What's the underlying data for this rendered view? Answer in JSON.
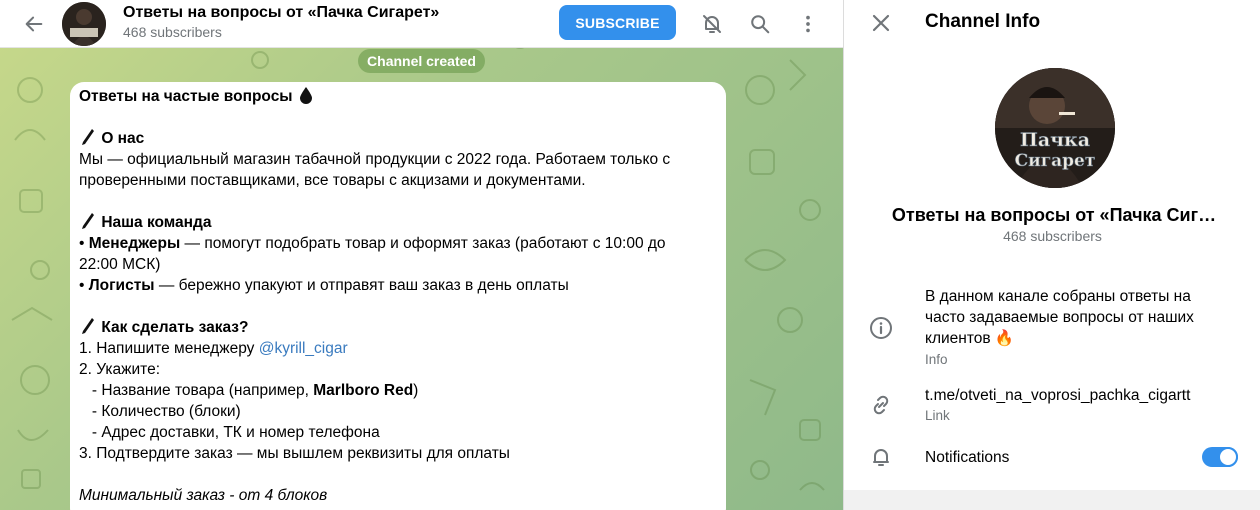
{
  "header": {
    "channel_title": "Ответы на вопросы от «Пачка Сигарет»",
    "subscribers": "468 subscribers",
    "subscribe_label": "SUBSCRIBE",
    "icons": [
      "arrow-left-icon",
      "bell-off-icon",
      "search-icon",
      "more-vertical-icon"
    ]
  },
  "service_message": "Channel created",
  "message": {
    "heading": "Ответы на частые вопросы",
    "about_title": "О нас",
    "about_line1": "Мы — официальный магазин табачной продукции с 2022 года. Работаем только с",
    "about_line2": "проверенными поставщиками, все товары с акцизами и документами.",
    "team_title": "Наша команда",
    "team_bullet": "•",
    "managers_label": "Менеджеры",
    "managers_text1": " — помогут подобрать товар и оформят заказ (работают с 10:00 до",
    "managers_text2": "22:00 МСК)",
    "logists_label": "Логисты",
    "logists_text": " — бережно упакуют и отправят ваш заказ в день оплаты",
    "order_title": "Как сделать заказ?",
    "step1": "1. Напишите менеджеру ",
    "step1_link": "@kyrill_cigar",
    "step2": "2. Укажите:",
    "step2_a_prefix": "   - Название товара (например, ",
    "step2_a_bold": "Marlboro Red",
    "step2_a_suffix": ")",
    "step2_b": "   - Количество (блоки)",
    "step2_c": "   - Адрес доставки, ТК и номер телефона",
    "step3": "3. Подтвердите заказ — мы вышлем реквизиты для оплаты",
    "min_order": "Минимальный заказ - от 4 блоков"
  },
  "info_panel": {
    "title": "Channel Info",
    "channel_name": "Ответы на вопросы от «Пачка Сиг…",
    "subscribers": "468 subscribers",
    "description_line1": "В данном канале собраны ответы на",
    "description_line2": "часто задаваемые вопросы от наших",
    "description_line3": "клиентов 🔥",
    "description_caption": "Info",
    "link": "t.me/otveti_na_voprosi_pachka_cigartt",
    "link_caption": "Link",
    "notifications_label": "Notifications",
    "notifications_on": true,
    "avatar_text_line1": "Пачка",
    "avatar_text_line2": "Сигарет"
  },
  "colors": {
    "accent": "#3390ec",
    "secondary_text": "#707579",
    "link": "#3a7bbf"
  }
}
